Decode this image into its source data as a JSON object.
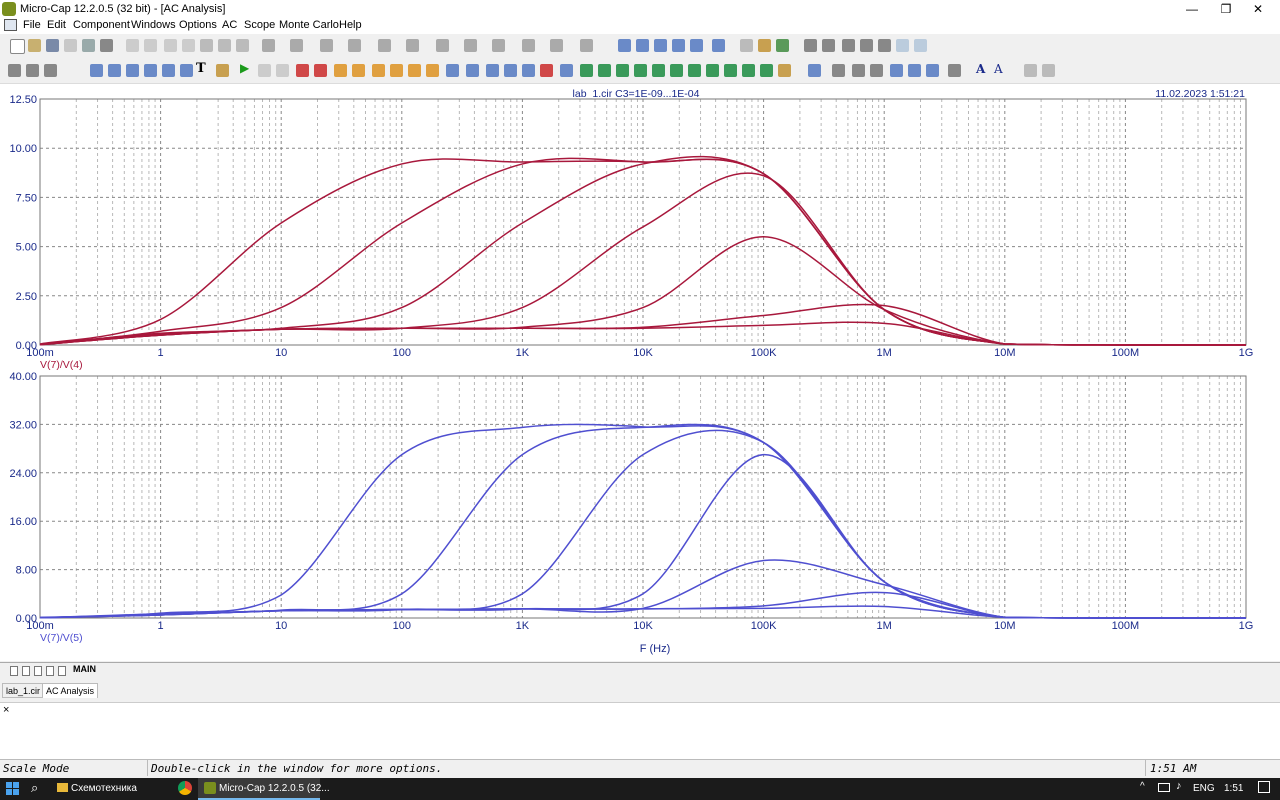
{
  "window": {
    "title": "Micro-Cap 12.2.0.5 (32 bit) - [AC Analysis]",
    "controls": {
      "minimize": "—",
      "restore": "❐",
      "close": "✕"
    }
  },
  "menu": [
    "File",
    "Edit",
    "Component",
    "Windows",
    "Options",
    "AC",
    "Scope",
    "Monte Carlo",
    "Help"
  ],
  "plot_header": {
    "circuit_info": "lab_1.cir C3=1E-09...1E-04",
    "timestamp": "11.02.2023 1:51:21"
  },
  "chart_data": [
    {
      "type": "line",
      "x_scale": "log",
      "xlabel": "",
      "ylabel": "V(7)/V(4)",
      "xlim": [
        0.1,
        1000000000
      ],
      "ylim": [
        0,
        12.5
      ],
      "x_tick_labels": [
        "100m",
        "1",
        "10",
        "100",
        "1K",
        "10K",
        "100K",
        "1M",
        "10M",
        "100M",
        "1G"
      ],
      "y_tick_labels": [
        "0.00",
        "2.50",
        "5.00",
        "7.50",
        "10.00",
        "12.50"
      ],
      "grid": true,
      "color": "#a8183c",
      "x": [
        0.1,
        1,
        10,
        100,
        1000,
        10000,
        100000,
        1000000,
        10000000,
        100000000,
        1000000000
      ],
      "series": [
        {
          "values": [
            0.05,
            1.3,
            6.2,
            9.2,
            9.3,
            9.3,
            8.7,
            1.8,
            0.05,
            0,
            0
          ]
        },
        {
          "values": [
            0.03,
            0.7,
            1.9,
            6.2,
            9.2,
            9.3,
            8.7,
            1.8,
            0.05,
            0,
            0
          ]
        },
        {
          "values": [
            0.02,
            0.6,
            0.85,
            1.9,
            6.2,
            9.2,
            8.7,
            1.8,
            0.05,
            0,
            0
          ]
        },
        {
          "values": [
            0.02,
            0.55,
            0.8,
            0.85,
            1.9,
            6.0,
            8.6,
            1.8,
            0.05,
            0,
            0
          ]
        },
        {
          "values": [
            0.02,
            0.5,
            0.8,
            0.85,
            0.9,
            1.9,
            5.5,
            1.8,
            0.05,
            0,
            0
          ]
        },
        {
          "values": [
            0.02,
            0.5,
            0.8,
            0.85,
            0.85,
            0.9,
            1.5,
            2.0,
            0.05,
            0,
            0
          ]
        },
        {
          "values": [
            0.02,
            0.5,
            0.8,
            0.85,
            0.85,
            0.85,
            1.0,
            1.1,
            0.05,
            0,
            0
          ]
        }
      ]
    },
    {
      "type": "line",
      "x_scale": "log",
      "xlabel": "F (Hz)",
      "ylabel": "V(7)/V(5)",
      "xlim": [
        0.1,
        1000000000
      ],
      "ylim": [
        0,
        40
      ],
      "x_tick_labels": [
        "100m",
        "1",
        "10",
        "100",
        "1K",
        "10K",
        "100K",
        "1M",
        "10M",
        "100M",
        "1G"
      ],
      "y_tick_labels": [
        "0.00",
        "8.00",
        "16.00",
        "24.00",
        "32.00",
        "40.00"
      ],
      "grid": true,
      "color": "#4f4fd0",
      "x": [
        0.1,
        1,
        10,
        100,
        1000,
        10000,
        100000,
        1000000,
        10000000,
        100000000,
        1000000000
      ],
      "series": [
        {
          "values": [
            0.1,
            0.8,
            3.8,
            27,
            31.5,
            31.6,
            29,
            6.0,
            0.1,
            0,
            0
          ]
        },
        {
          "values": [
            0.05,
            0.7,
            1.3,
            4.0,
            27,
            31.5,
            29,
            6.0,
            0.1,
            0,
            0
          ]
        },
        {
          "values": [
            0.05,
            0.6,
            1.2,
            1.4,
            4.0,
            27,
            29,
            6.0,
            0.1,
            0,
            0
          ]
        },
        {
          "values": [
            0.05,
            0.55,
            1.2,
            1.4,
            1.5,
            4.0,
            27,
            6.0,
            0.1,
            0,
            0
          ]
        },
        {
          "values": [
            0.05,
            0.5,
            1.2,
            1.4,
            1.5,
            1.6,
            9.5,
            5.5,
            0.1,
            0,
            0
          ]
        },
        {
          "values": [
            0.05,
            0.5,
            1.2,
            1.4,
            1.5,
            1.5,
            2.0,
            4.2,
            0.1,
            0,
            0
          ]
        },
        {
          "values": [
            0.05,
            0.5,
            1.2,
            1.4,
            1.5,
            1.5,
            1.6,
            1.9,
            0.1,
            0,
            0
          ]
        }
      ]
    }
  ],
  "tabs": {
    "main": "MAIN",
    "nav": [
      "|◀",
      "◀◀",
      "◀",
      "▶",
      "▶|"
    ]
  },
  "doc_tabs": [
    "lab_1.cir",
    "AC Analysis"
  ],
  "output_close": "×",
  "status": {
    "mode": "Scale Mode",
    "hint": "Double-click in the window for more options.",
    "time": "1:51 AM"
  },
  "taskbar": {
    "search_icon": "search-icon",
    "items": [
      "Схемотехника",
      "Micro-Cap 12.2.0.5 (32..."
    ],
    "lang": "ENG",
    "clock": "1:51"
  },
  "colors": {
    "curve1": "#a8183c",
    "curve2": "#4f4fd0",
    "axis": "#1a2a8a"
  }
}
